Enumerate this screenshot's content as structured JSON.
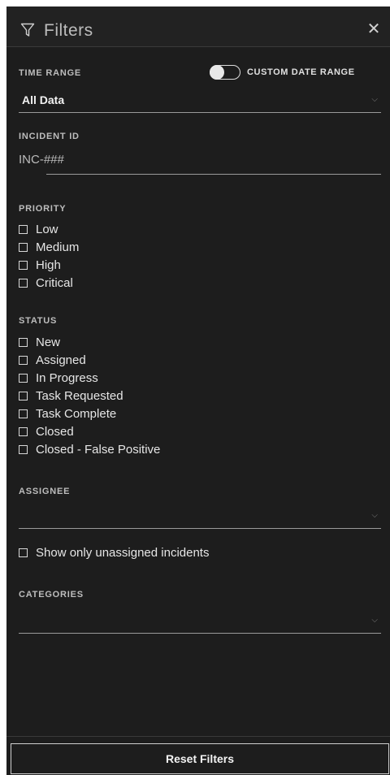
{
  "header": {
    "title": "Filters",
    "funnel_icon": "funnel-icon",
    "close_icon": "close-icon",
    "close_glyph": "✕"
  },
  "time_range": {
    "label": "TIME RANGE",
    "toggle_label": "CUSTOM DATE RANGE",
    "toggle_on": false,
    "value": "All Data",
    "chevron": "⌵"
  },
  "incident_id": {
    "label": "INCIDENT ID",
    "prefix": "INC-###",
    "value": ""
  },
  "priority": {
    "label": "PRIORITY",
    "options": [
      {
        "label": "Low",
        "checked": false
      },
      {
        "label": "Medium",
        "checked": false
      },
      {
        "label": "High",
        "checked": false
      },
      {
        "label": "Critical",
        "checked": false
      }
    ]
  },
  "status": {
    "label": "STATUS",
    "options": [
      {
        "label": "New",
        "checked": false
      },
      {
        "label": "Assigned",
        "checked": false
      },
      {
        "label": "In Progress",
        "checked": false
      },
      {
        "label": "Task Requested",
        "checked": false
      },
      {
        "label": "Task Complete",
        "checked": false
      },
      {
        "label": "Closed",
        "checked": false
      },
      {
        "label": "Closed - False Positive",
        "checked": false
      }
    ]
  },
  "assignee": {
    "label": "ASSIGNEE",
    "value": "",
    "chevron": "⌵"
  },
  "unassigned": {
    "label": "Show only unassigned incidents",
    "checked": false
  },
  "categories": {
    "label": "CATEGORIES",
    "value": "",
    "chevron": "⌵"
  },
  "footer": {
    "reset_label": "Reset Filters"
  },
  "colors": {
    "panel": "#1d1d1d",
    "header": "#222222",
    "text": "#e6e6e6",
    "muted": "#bdbdbd"
  }
}
